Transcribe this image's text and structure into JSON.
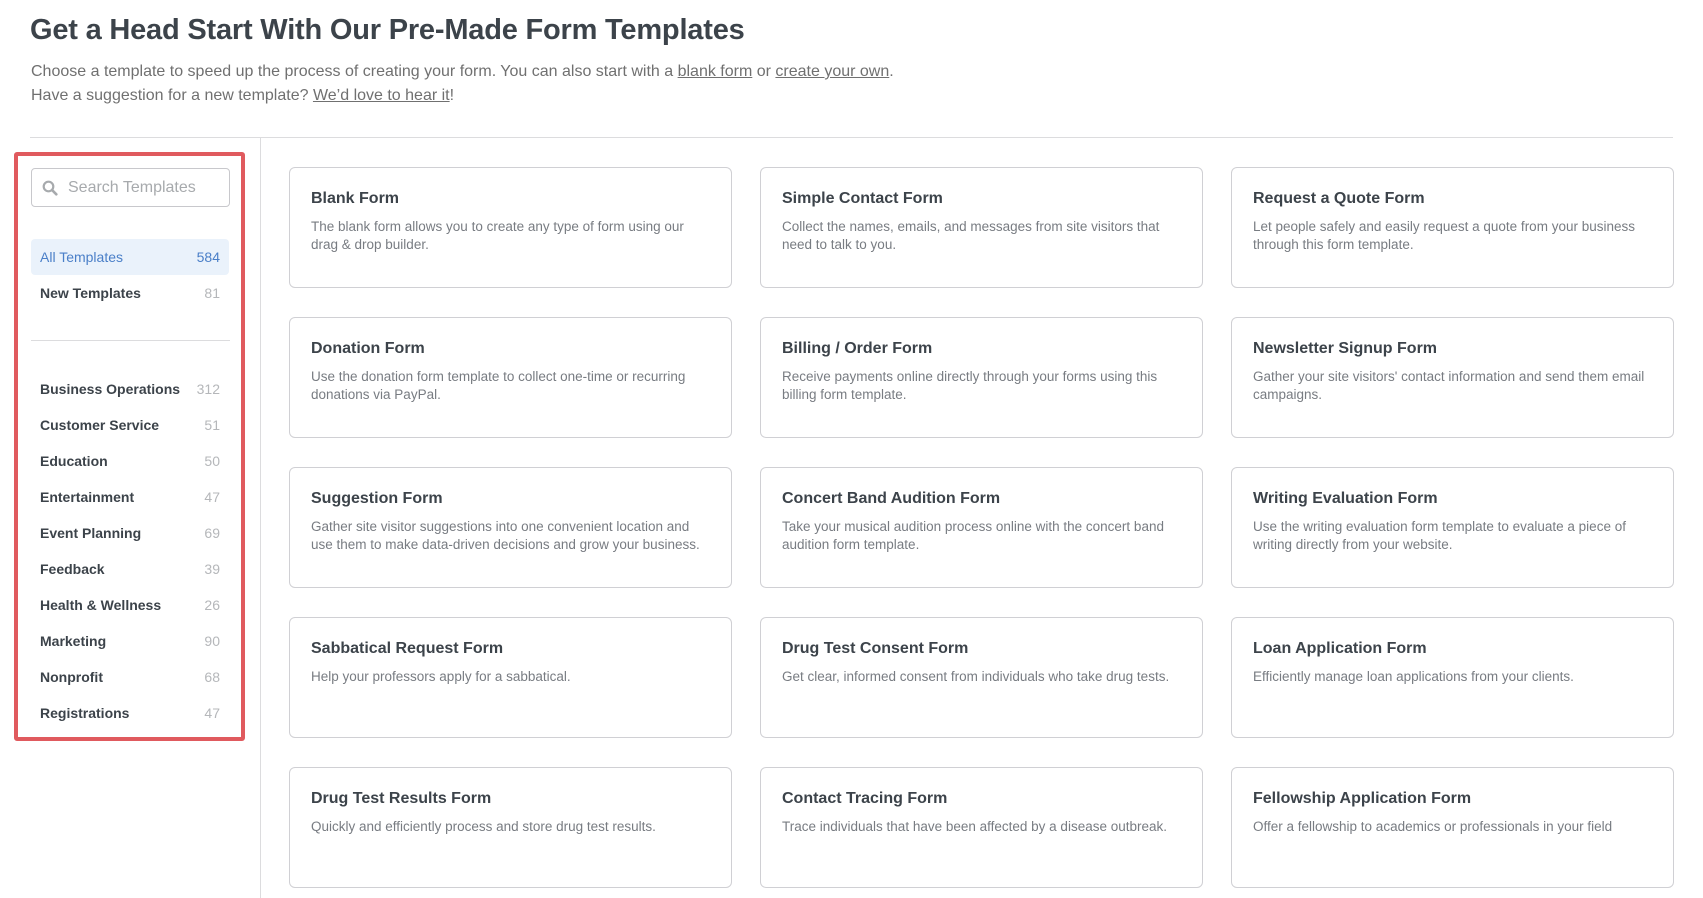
{
  "header": {
    "title": "Get a Head Start With Our Pre-Made Form Templates",
    "intro_line1_prefix": "Choose a template to speed up the process of creating your form. You can also start with a ",
    "blank_form_link": "blank form",
    "intro_line1_middle": " or ",
    "create_own_link": "create your own",
    "intro_line1_suffix": ".",
    "intro_line2_prefix": "Have a suggestion for a new template? ",
    "suggestion_link": "We’d love to hear it",
    "intro_line2_suffix": "!"
  },
  "sidebar": {
    "search": {
      "placeholder": "Search Templates",
      "value": "",
      "icon": "search-icon"
    },
    "top_items": [
      {
        "label": "All Templates",
        "count": "584",
        "active": true
      },
      {
        "label": "New Templates",
        "count": "81",
        "active": false
      }
    ],
    "categories": [
      {
        "label": "Business Operations",
        "count": "312"
      },
      {
        "label": "Customer Service",
        "count": "51"
      },
      {
        "label": "Education",
        "count": "50"
      },
      {
        "label": "Entertainment",
        "count": "47"
      },
      {
        "label": "Event Planning",
        "count": "69"
      },
      {
        "label": "Feedback",
        "count": "39"
      },
      {
        "label": "Health & Wellness",
        "count": "26"
      },
      {
        "label": "Marketing",
        "count": "90"
      },
      {
        "label": "Nonprofit",
        "count": "68"
      },
      {
        "label": "Registrations",
        "count": "47"
      }
    ]
  },
  "templates": [
    {
      "title": "Blank Form",
      "description": "The blank form allows you to create any type of form using our drag & drop builder."
    },
    {
      "title": "Simple Contact Form",
      "description": "Collect the names, emails, and messages from site visitors that need to talk to you."
    },
    {
      "title": "Request a Quote Form",
      "description": "Let people safely and easily request a quote from your business through this form template."
    },
    {
      "title": "Donation Form",
      "description": "Use the donation form template to collect one-time or recurring donations via PayPal."
    },
    {
      "title": "Billing / Order Form",
      "description": "Receive payments online directly through your forms using this billing form template."
    },
    {
      "title": "Newsletter Signup Form",
      "description": "Gather your site visitors' contact information and send them email campaigns."
    },
    {
      "title": "Suggestion Form",
      "description": "Gather site visitor suggestions into one convenient location and use them to make data-driven decisions and grow your business."
    },
    {
      "title": "Concert Band Audition Form",
      "description": "Take your musical audition process online with the concert band audition form template."
    },
    {
      "title": "Writing Evaluation Form",
      "description": "Use the writing evaluation form template to evaluate a piece of writing directly from your website."
    },
    {
      "title": "Sabbatical Request Form",
      "description": "Help your professors apply for a sabbatical."
    },
    {
      "title": "Drug Test Consent Form",
      "description": "Get clear, informed consent from individuals who take drug tests."
    },
    {
      "title": "Loan Application Form",
      "description": "Efficiently manage loan applications from your clients."
    },
    {
      "title": "Drug Test Results Form",
      "description": "Quickly and efficiently process and store drug test results."
    },
    {
      "title": "Contact Tracing Form",
      "description": "Trace individuals that have been affected by a disease outbreak."
    },
    {
      "title": "Fellowship Application Form",
      "description": "Offer a fellowship to academics or professionals in your field"
    }
  ],
  "colors": {
    "accent": "#4a7fc8",
    "active_bg": "#eaf2fb",
    "highlight_frame": "#e05a5e"
  }
}
